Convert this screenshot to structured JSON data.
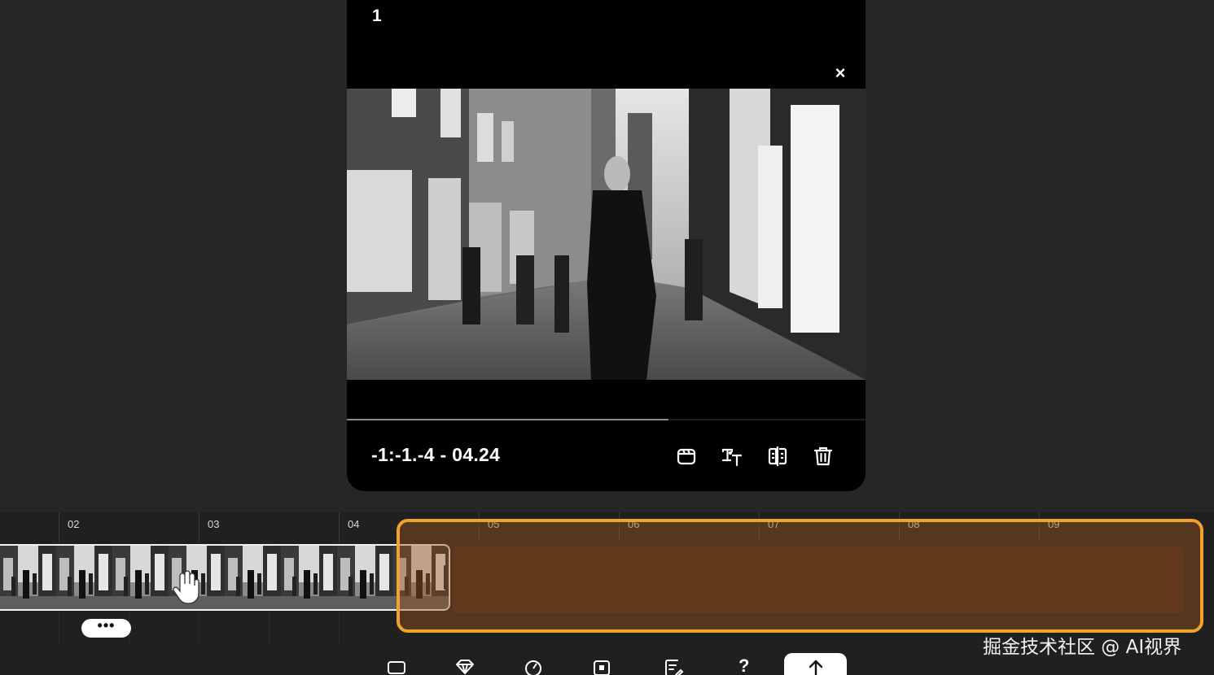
{
  "preview": {
    "clip_index": "1",
    "close_symbol": "×",
    "video_content": "black-and-white street scene",
    "progress_fraction": 0.62,
    "timecode": "-1:-1.-4 - 04.24",
    "tools": [
      {
        "icon": "clapperboard-icon"
      },
      {
        "icon": "text-style-icon"
      },
      {
        "icon": "split-icon"
      },
      {
        "icon": "trash-icon"
      }
    ]
  },
  "timeline": {
    "ruler_labels": [
      "02",
      "03",
      "04",
      "05",
      "06",
      "07",
      "08",
      "09"
    ],
    "more_label": "•••",
    "drop_zone_color": "#f0a32e"
  },
  "bottom_toolbar": {
    "icons": [
      "frame-icon",
      "diamond-icon",
      "speed-icon",
      "crop-icon",
      "notes-icon"
    ],
    "help_label": "?",
    "upload_icon": "upload-arrow-icon"
  },
  "watermark": "掘金技术社区 @ AI视界"
}
